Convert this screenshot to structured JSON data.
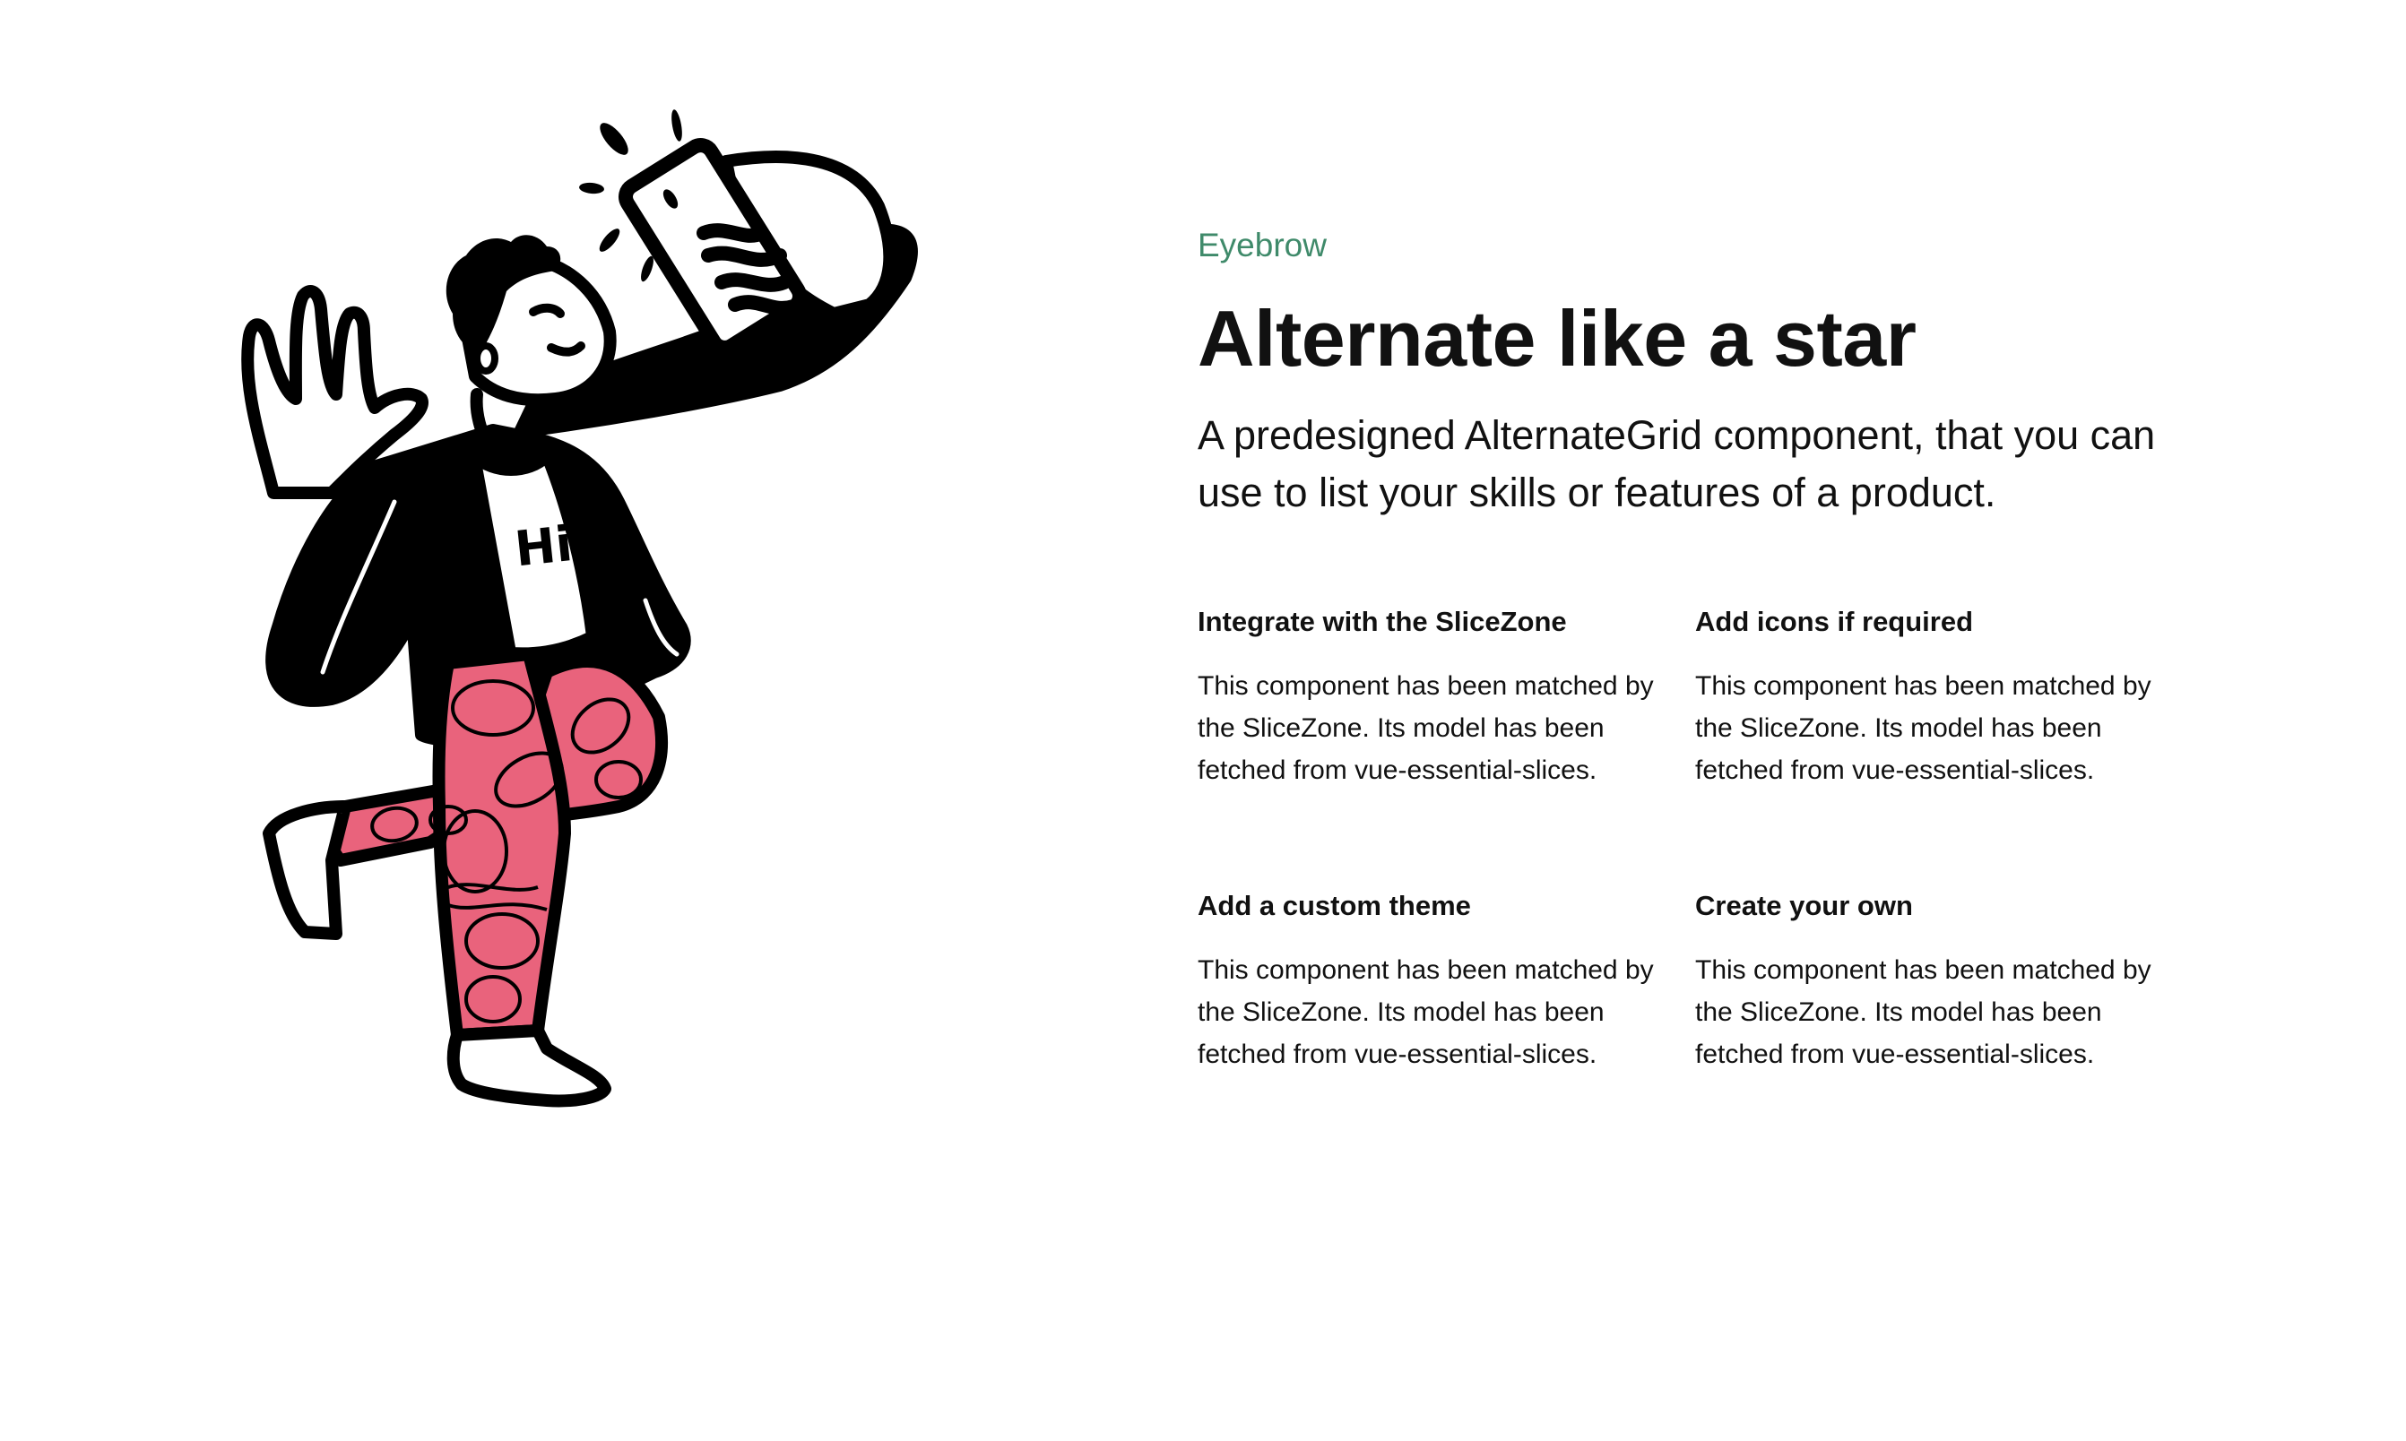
{
  "theme": {
    "accent": "#3f8a6a",
    "text": "#111111",
    "illustration_black": "#000000",
    "pants_pink": "#e9637c"
  },
  "illustration": {
    "shirt_text": "Hi"
  },
  "hero": {
    "eyebrow": "Eyebrow",
    "title": "Alternate like a star",
    "description": "A predesigned AlternateGrid component, that you can use to list your skills or features of a product."
  },
  "features": [
    {
      "title": "Integrate with the SliceZone",
      "text": "This component has been matched by the SliceZone. Its model has been fetched from vue-essential-slices."
    },
    {
      "title": "Add icons if required",
      "text": "This component has been matched by the SliceZone. Its model has been fetched from vue-essential-slices."
    },
    {
      "title": "Add a custom theme",
      "text": "This component has been matched by the SliceZone. Its model has been fetched from vue-essential-slices."
    },
    {
      "title": "Create your own",
      "text": "This component has been matched by the SliceZone. Its model has been fetched from vue-essential-slices."
    }
  ]
}
